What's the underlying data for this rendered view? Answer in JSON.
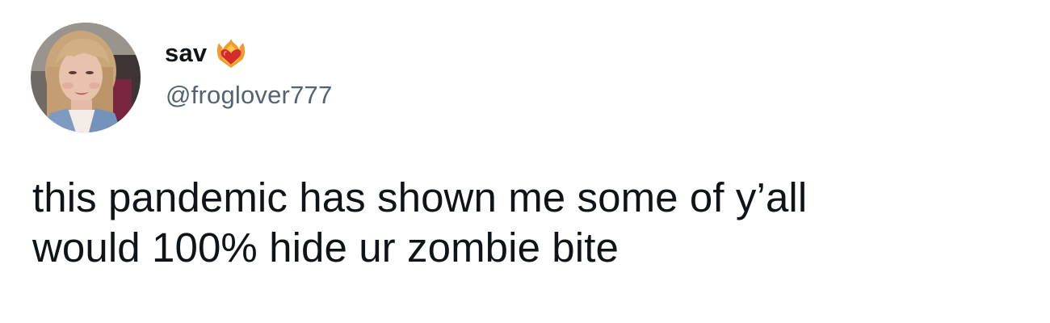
{
  "tweet": {
    "author": {
      "display_name": "sav",
      "handle": "@froglover777",
      "name_emoji": "heart-on-fire-icon"
    },
    "text_lines": [
      "this pandemic has shown me some of y’all",
      "would 100% hide ur zombie bite"
    ]
  },
  "colors": {
    "text_primary": "#0f1419",
    "text_secondary": "#536471",
    "background": "#ffffff"
  }
}
